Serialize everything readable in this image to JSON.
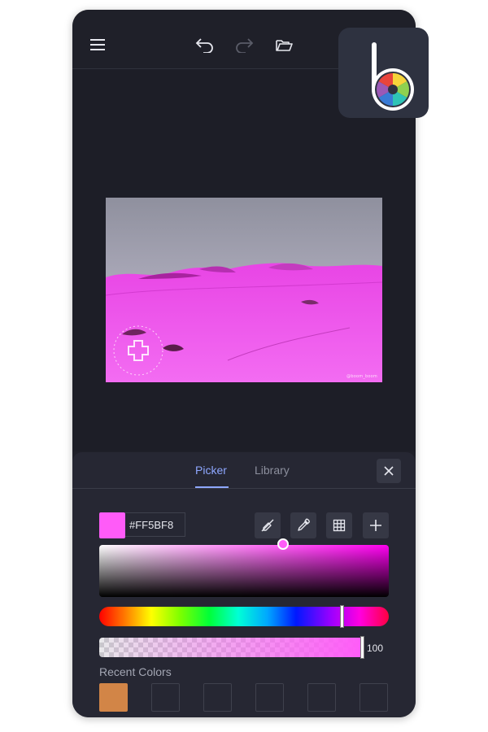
{
  "toolbar": {
    "menu_icon": "hamburger-icon",
    "undo_icon": "undo-icon",
    "redo_icon": "redo-icon",
    "open_icon": "folder-open-icon"
  },
  "logo": {
    "icon": "befunky-logo",
    "letter": "b"
  },
  "photo": {
    "caption": "@boom_boom"
  },
  "picker_panel": {
    "tabs": [
      {
        "label": "Picker",
        "active": true
      },
      {
        "label": "Library",
        "active": false
      }
    ],
    "close_icon": "close-icon",
    "current_color": "#FF5BF8",
    "hex_value": "#FF5BF8",
    "tools": [
      {
        "icon": "no-color-icon"
      },
      {
        "icon": "eyedropper-icon"
      },
      {
        "icon": "grid-icon"
      },
      {
        "icon": "plus-icon"
      }
    ],
    "alpha_value": "100",
    "recent_colors_label": "Recent Colors",
    "recent_colors": [
      "#D28547",
      "",
      "",
      "",
      "",
      ""
    ]
  },
  "colors": {
    "app_bg": "#1F2029",
    "panel_bg": "#262733",
    "accent": "#8EA7FF",
    "selected_color": "#FF5BF8"
  }
}
